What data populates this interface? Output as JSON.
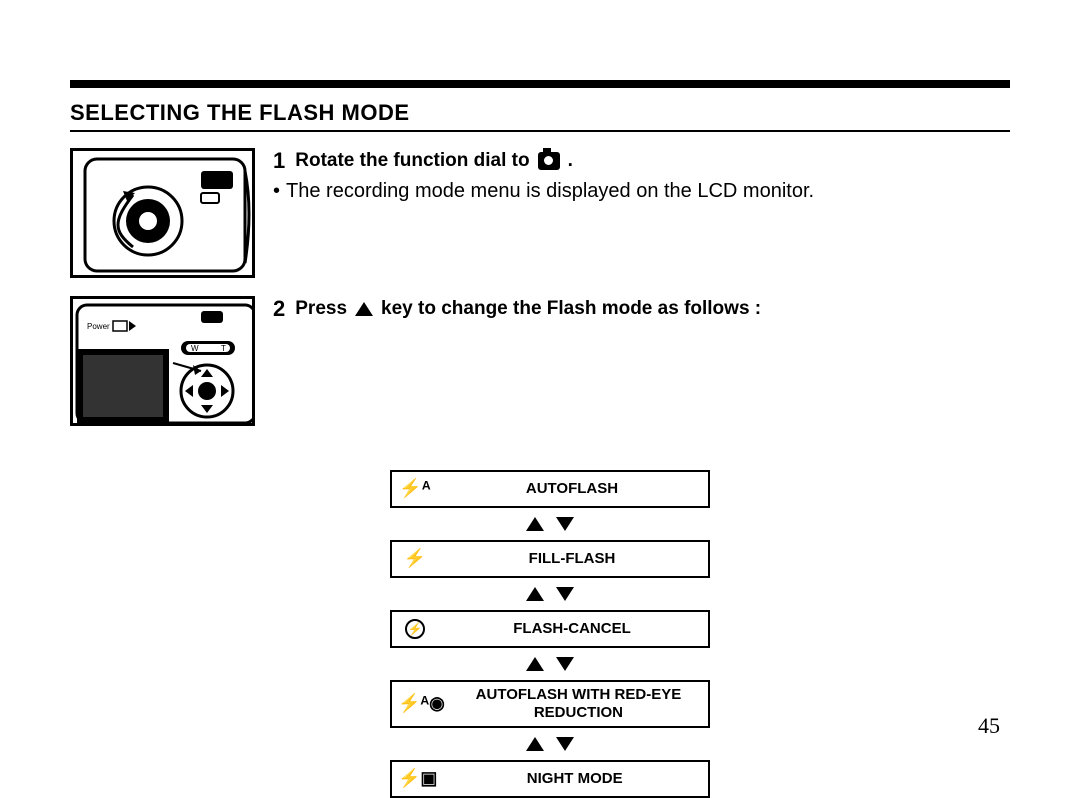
{
  "section_title": "SELECTING THE FLASH MODE",
  "step1": {
    "num": "1",
    "text": "Rotate the function dial to",
    "period": ".",
    "bullet_dot": "•",
    "bullet": "The recording mode menu is displayed on the LCD monitor."
  },
  "step2": {
    "num": "2",
    "text_before": "Press",
    "text_after": "key to change the Flash mode as follows :"
  },
  "modes": {
    "m1": {
      "icon": "flash-auto-icon",
      "glyph": "⚡ᴬ",
      "label": "AUTOFLASH"
    },
    "m2": {
      "icon": "flash-icon",
      "glyph": "⚡",
      "label": "FILL-FLASH"
    },
    "m3": {
      "icon": "flash-cancel-icon",
      "glyph": "⦸",
      "label": "FLASH-CANCEL"
    },
    "m4": {
      "icon": "flash-redeye-icon",
      "glyph": "⚡ᴬ◉",
      "label_line1": "AUTOFLASH WITH RED-EYE",
      "label_line2": "REDUCTION"
    },
    "m5": {
      "icon": "flash-night-icon",
      "glyph": "⚡▣",
      "label": "NIGHT MODE"
    }
  },
  "page_number": "45",
  "illustrations": {
    "illus1_alt": "Camera top with function dial set to camera mode",
    "illus2_alt": "Camera back with control pad and up key highlighted",
    "power_label": "Power",
    "zoom_w": "W",
    "zoom_t": "T"
  }
}
